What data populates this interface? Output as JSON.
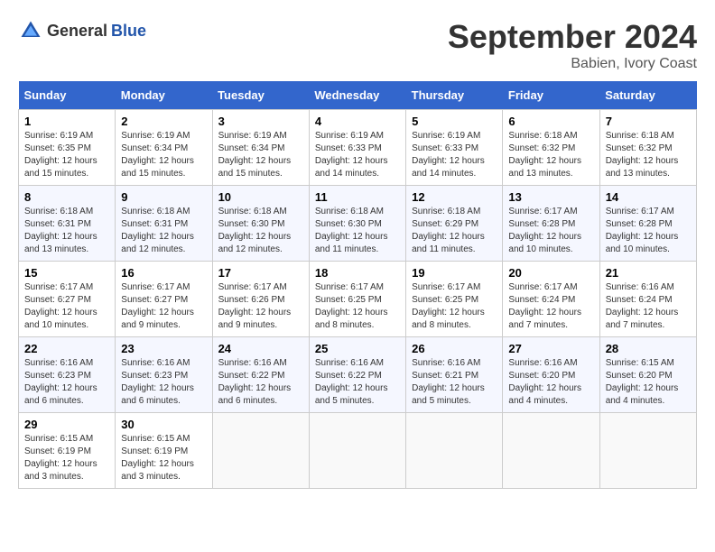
{
  "header": {
    "logo_general": "General",
    "logo_blue": "Blue",
    "month": "September 2024",
    "location": "Babien, Ivory Coast"
  },
  "weekdays": [
    "Sunday",
    "Monday",
    "Tuesday",
    "Wednesday",
    "Thursday",
    "Friday",
    "Saturday"
  ],
  "weeks": [
    [
      {
        "day": "1",
        "sunrise": "6:19 AM",
        "sunset": "6:35 PM",
        "daylight": "12 hours and 15 minutes."
      },
      {
        "day": "2",
        "sunrise": "6:19 AM",
        "sunset": "6:34 PM",
        "daylight": "12 hours and 15 minutes."
      },
      {
        "day": "3",
        "sunrise": "6:19 AM",
        "sunset": "6:34 PM",
        "daylight": "12 hours and 15 minutes."
      },
      {
        "day": "4",
        "sunrise": "6:19 AM",
        "sunset": "6:33 PM",
        "daylight": "12 hours and 14 minutes."
      },
      {
        "day": "5",
        "sunrise": "6:19 AM",
        "sunset": "6:33 PM",
        "daylight": "12 hours and 14 minutes."
      },
      {
        "day": "6",
        "sunrise": "6:18 AM",
        "sunset": "6:32 PM",
        "daylight": "12 hours and 13 minutes."
      },
      {
        "day": "7",
        "sunrise": "6:18 AM",
        "sunset": "6:32 PM",
        "daylight": "12 hours and 13 minutes."
      }
    ],
    [
      {
        "day": "8",
        "sunrise": "6:18 AM",
        "sunset": "6:31 PM",
        "daylight": "12 hours and 13 minutes."
      },
      {
        "day": "9",
        "sunrise": "6:18 AM",
        "sunset": "6:31 PM",
        "daylight": "12 hours and 12 minutes."
      },
      {
        "day": "10",
        "sunrise": "6:18 AM",
        "sunset": "6:30 PM",
        "daylight": "12 hours and 12 minutes."
      },
      {
        "day": "11",
        "sunrise": "6:18 AM",
        "sunset": "6:30 PM",
        "daylight": "12 hours and 11 minutes."
      },
      {
        "day": "12",
        "sunrise": "6:18 AM",
        "sunset": "6:29 PM",
        "daylight": "12 hours and 11 minutes."
      },
      {
        "day": "13",
        "sunrise": "6:17 AM",
        "sunset": "6:28 PM",
        "daylight": "12 hours and 10 minutes."
      },
      {
        "day": "14",
        "sunrise": "6:17 AM",
        "sunset": "6:28 PM",
        "daylight": "12 hours and 10 minutes."
      }
    ],
    [
      {
        "day": "15",
        "sunrise": "6:17 AM",
        "sunset": "6:27 PM",
        "daylight": "12 hours and 10 minutes."
      },
      {
        "day": "16",
        "sunrise": "6:17 AM",
        "sunset": "6:27 PM",
        "daylight": "12 hours and 9 minutes."
      },
      {
        "day": "17",
        "sunrise": "6:17 AM",
        "sunset": "6:26 PM",
        "daylight": "12 hours and 9 minutes."
      },
      {
        "day": "18",
        "sunrise": "6:17 AM",
        "sunset": "6:25 PM",
        "daylight": "12 hours and 8 minutes."
      },
      {
        "day": "19",
        "sunrise": "6:17 AM",
        "sunset": "6:25 PM",
        "daylight": "12 hours and 8 minutes."
      },
      {
        "day": "20",
        "sunrise": "6:17 AM",
        "sunset": "6:24 PM",
        "daylight": "12 hours and 7 minutes."
      },
      {
        "day": "21",
        "sunrise": "6:16 AM",
        "sunset": "6:24 PM",
        "daylight": "12 hours and 7 minutes."
      }
    ],
    [
      {
        "day": "22",
        "sunrise": "6:16 AM",
        "sunset": "6:23 PM",
        "daylight": "12 hours and 6 minutes."
      },
      {
        "day": "23",
        "sunrise": "6:16 AM",
        "sunset": "6:23 PM",
        "daylight": "12 hours and 6 minutes."
      },
      {
        "day": "24",
        "sunrise": "6:16 AM",
        "sunset": "6:22 PM",
        "daylight": "12 hours and 6 minutes."
      },
      {
        "day": "25",
        "sunrise": "6:16 AM",
        "sunset": "6:22 PM",
        "daylight": "12 hours and 5 minutes."
      },
      {
        "day": "26",
        "sunrise": "6:16 AM",
        "sunset": "6:21 PM",
        "daylight": "12 hours and 5 minutes."
      },
      {
        "day": "27",
        "sunrise": "6:16 AM",
        "sunset": "6:20 PM",
        "daylight": "12 hours and 4 minutes."
      },
      {
        "day": "28",
        "sunrise": "6:15 AM",
        "sunset": "6:20 PM",
        "daylight": "12 hours and 4 minutes."
      }
    ],
    [
      {
        "day": "29",
        "sunrise": "6:15 AM",
        "sunset": "6:19 PM",
        "daylight": "12 hours and 3 minutes."
      },
      {
        "day": "30",
        "sunrise": "6:15 AM",
        "sunset": "6:19 PM",
        "daylight": "12 hours and 3 minutes."
      },
      {
        "day": "",
        "sunrise": "",
        "sunset": "",
        "daylight": ""
      },
      {
        "day": "",
        "sunrise": "",
        "sunset": "",
        "daylight": ""
      },
      {
        "day": "",
        "sunrise": "",
        "sunset": "",
        "daylight": ""
      },
      {
        "day": "",
        "sunrise": "",
        "sunset": "",
        "daylight": ""
      },
      {
        "day": "",
        "sunrise": "",
        "sunset": "",
        "daylight": ""
      }
    ]
  ]
}
